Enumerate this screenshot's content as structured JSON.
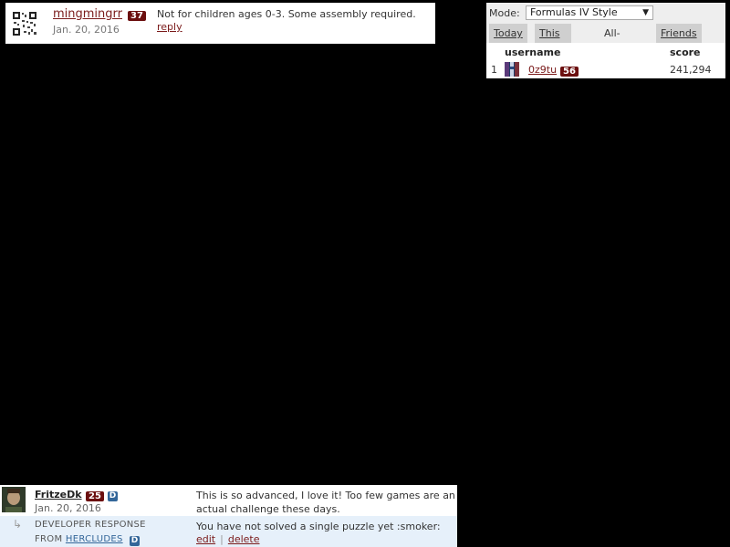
{
  "top_comment": {
    "username": "mingmingrr",
    "level": "37",
    "date": "Jan. 20, 2016",
    "text": "Not for children ages 0-3. Some assembly required.",
    "reply_label": "reply"
  },
  "leaderboard": {
    "mode_label": "Mode:",
    "mode_value": "Formulas IV Style",
    "tabs": [
      {
        "label": "Today",
        "active": false
      },
      {
        "label": "This Week",
        "active": false
      },
      {
        "label": "All-Time",
        "active": true
      },
      {
        "label": "Friends",
        "active": false
      }
    ],
    "headers": {
      "username": "username",
      "score": "score"
    },
    "rows": [
      {
        "rank": "1",
        "username": "0z9tu",
        "level": "56",
        "score": "241,294"
      }
    ]
  },
  "bottom_comment": {
    "username": "FritzeDk",
    "level": "25",
    "dev_badge": "D",
    "date": "Jan. 20, 2016",
    "text": "This is so advanced, I love it! Too few games are an actual challenge these days.",
    "dev_response": {
      "label": "DEVELOPER RESPONSE",
      "from_prefix": "FROM",
      "developer": "HERCLUDES",
      "developer_badge": "D",
      "text": "You have not solved a single puzzle yet :smoker:",
      "edit_label": "edit",
      "separator": "|",
      "delete_label": "delete"
    }
  },
  "colors": {
    "background": "#000000",
    "level_badge": "#6b0f0f",
    "dev_badge": "#336699",
    "dev_response_bg": "#e6f0fa",
    "link": "#7a1a1a"
  },
  "icons": {
    "top_avatar": "qr-code-avatar-icon",
    "leaderboard_avatar": "pixel-avatar-icon",
    "bottom_avatar": "user-photo-avatar-icon",
    "reply_arrow": "reply-arrow-icon",
    "dropdown": "caret-down-icon"
  }
}
